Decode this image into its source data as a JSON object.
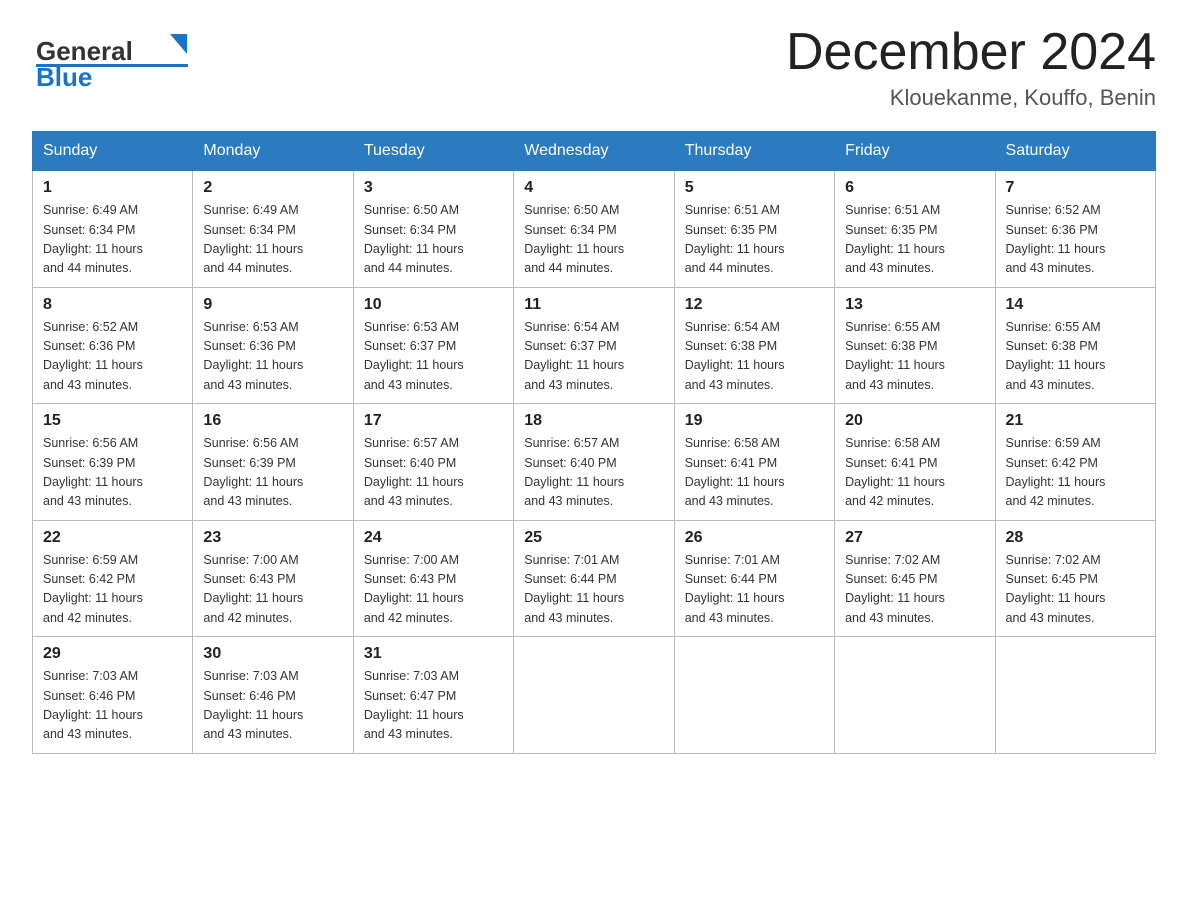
{
  "header": {
    "logo_general": "General",
    "logo_blue": "Blue",
    "month_title": "December 2024",
    "location": "Klouekanme, Kouffo, Benin"
  },
  "days_of_week": [
    "Sunday",
    "Monday",
    "Tuesday",
    "Wednesday",
    "Thursday",
    "Friday",
    "Saturday"
  ],
  "weeks": [
    [
      {
        "day": "1",
        "sunrise": "6:49 AM",
        "sunset": "6:34 PM",
        "daylight": "11 hours and 44 minutes."
      },
      {
        "day": "2",
        "sunrise": "6:49 AM",
        "sunset": "6:34 PM",
        "daylight": "11 hours and 44 minutes."
      },
      {
        "day": "3",
        "sunrise": "6:50 AM",
        "sunset": "6:34 PM",
        "daylight": "11 hours and 44 minutes."
      },
      {
        "day": "4",
        "sunrise": "6:50 AM",
        "sunset": "6:34 PM",
        "daylight": "11 hours and 44 minutes."
      },
      {
        "day": "5",
        "sunrise": "6:51 AM",
        "sunset": "6:35 PM",
        "daylight": "11 hours and 44 minutes."
      },
      {
        "day": "6",
        "sunrise": "6:51 AM",
        "sunset": "6:35 PM",
        "daylight": "11 hours and 43 minutes."
      },
      {
        "day": "7",
        "sunrise": "6:52 AM",
        "sunset": "6:36 PM",
        "daylight": "11 hours and 43 minutes."
      }
    ],
    [
      {
        "day": "8",
        "sunrise": "6:52 AM",
        "sunset": "6:36 PM",
        "daylight": "11 hours and 43 minutes."
      },
      {
        "day": "9",
        "sunrise": "6:53 AM",
        "sunset": "6:36 PM",
        "daylight": "11 hours and 43 minutes."
      },
      {
        "day": "10",
        "sunrise": "6:53 AM",
        "sunset": "6:37 PM",
        "daylight": "11 hours and 43 minutes."
      },
      {
        "day": "11",
        "sunrise": "6:54 AM",
        "sunset": "6:37 PM",
        "daylight": "11 hours and 43 minutes."
      },
      {
        "day": "12",
        "sunrise": "6:54 AM",
        "sunset": "6:38 PM",
        "daylight": "11 hours and 43 minutes."
      },
      {
        "day": "13",
        "sunrise": "6:55 AM",
        "sunset": "6:38 PM",
        "daylight": "11 hours and 43 minutes."
      },
      {
        "day": "14",
        "sunrise": "6:55 AM",
        "sunset": "6:38 PM",
        "daylight": "11 hours and 43 minutes."
      }
    ],
    [
      {
        "day": "15",
        "sunrise": "6:56 AM",
        "sunset": "6:39 PM",
        "daylight": "11 hours and 43 minutes."
      },
      {
        "day": "16",
        "sunrise": "6:56 AM",
        "sunset": "6:39 PM",
        "daylight": "11 hours and 43 minutes."
      },
      {
        "day": "17",
        "sunrise": "6:57 AM",
        "sunset": "6:40 PM",
        "daylight": "11 hours and 43 minutes."
      },
      {
        "day": "18",
        "sunrise": "6:57 AM",
        "sunset": "6:40 PM",
        "daylight": "11 hours and 43 minutes."
      },
      {
        "day": "19",
        "sunrise": "6:58 AM",
        "sunset": "6:41 PM",
        "daylight": "11 hours and 43 minutes."
      },
      {
        "day": "20",
        "sunrise": "6:58 AM",
        "sunset": "6:41 PM",
        "daylight": "11 hours and 42 minutes."
      },
      {
        "day": "21",
        "sunrise": "6:59 AM",
        "sunset": "6:42 PM",
        "daylight": "11 hours and 42 minutes."
      }
    ],
    [
      {
        "day": "22",
        "sunrise": "6:59 AM",
        "sunset": "6:42 PM",
        "daylight": "11 hours and 42 minutes."
      },
      {
        "day": "23",
        "sunrise": "7:00 AM",
        "sunset": "6:43 PM",
        "daylight": "11 hours and 42 minutes."
      },
      {
        "day": "24",
        "sunrise": "7:00 AM",
        "sunset": "6:43 PM",
        "daylight": "11 hours and 42 minutes."
      },
      {
        "day": "25",
        "sunrise": "7:01 AM",
        "sunset": "6:44 PM",
        "daylight": "11 hours and 43 minutes."
      },
      {
        "day": "26",
        "sunrise": "7:01 AM",
        "sunset": "6:44 PM",
        "daylight": "11 hours and 43 minutes."
      },
      {
        "day": "27",
        "sunrise": "7:02 AM",
        "sunset": "6:45 PM",
        "daylight": "11 hours and 43 minutes."
      },
      {
        "day": "28",
        "sunrise": "7:02 AM",
        "sunset": "6:45 PM",
        "daylight": "11 hours and 43 minutes."
      }
    ],
    [
      {
        "day": "29",
        "sunrise": "7:03 AM",
        "sunset": "6:46 PM",
        "daylight": "11 hours and 43 minutes."
      },
      {
        "day": "30",
        "sunrise": "7:03 AM",
        "sunset": "6:46 PM",
        "daylight": "11 hours and 43 minutes."
      },
      {
        "day": "31",
        "sunrise": "7:03 AM",
        "sunset": "6:47 PM",
        "daylight": "11 hours and 43 minutes."
      },
      null,
      null,
      null,
      null
    ]
  ],
  "labels": {
    "sunrise": "Sunrise:",
    "sunset": "Sunset:",
    "daylight": "Daylight:"
  }
}
